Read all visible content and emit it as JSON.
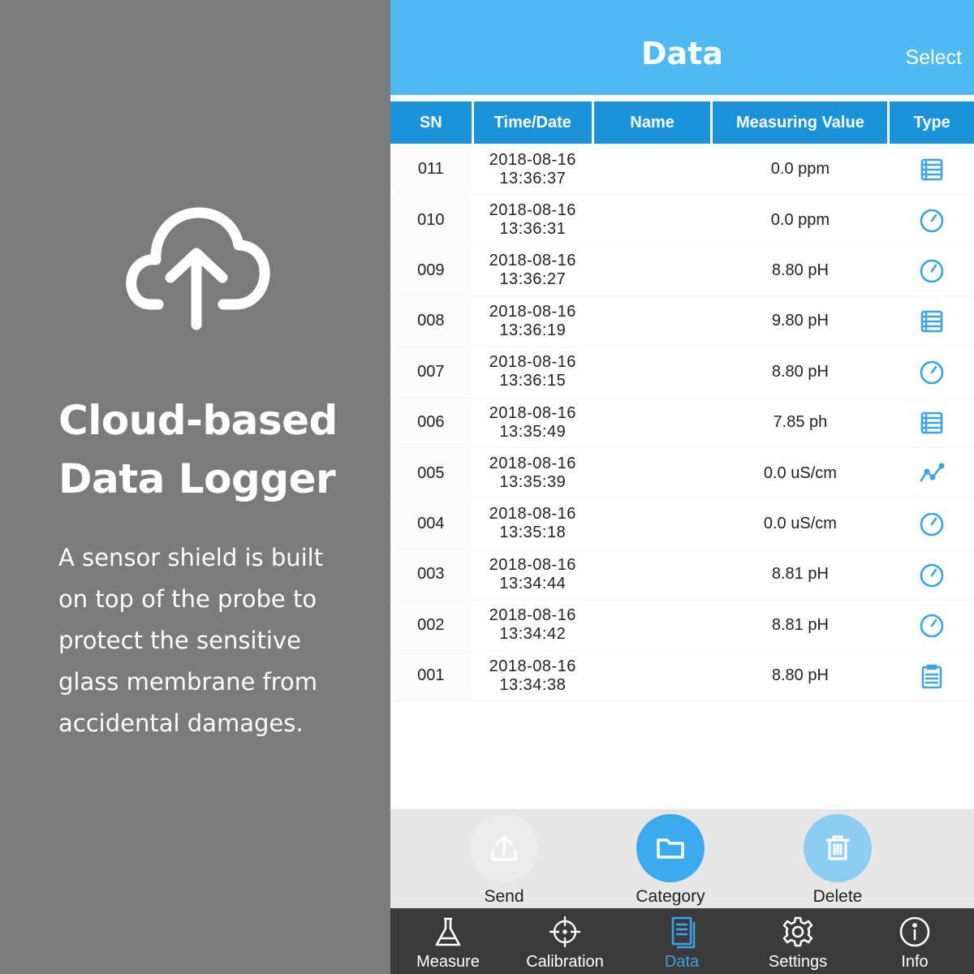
{
  "promo": {
    "icon": "cloud-upload-icon",
    "title_line1": "Cloud-based",
    "title_line2": "Data Logger",
    "description": "A sensor shield is built on top of the probe to protect the sensitive glass membrane from accidental damages."
  },
  "navbar": {
    "title": "Data",
    "select_label": "Select"
  },
  "table": {
    "headers": [
      "SN",
      "Time/Date",
      "Name",
      "Measuring Value",
      "Type"
    ],
    "rows": [
      {
        "sn": "011",
        "date": "2018-08-16",
        "time": "13:36:37",
        "name": "",
        "value": "0.0 ppm",
        "type": "table-icon"
      },
      {
        "sn": "010",
        "date": "2018-08-16",
        "time": "13:36:31",
        "name": "",
        "value": "0.0 ppm",
        "type": "gauge-icon"
      },
      {
        "sn": "009",
        "date": "2018-08-16",
        "time": "13:36:27",
        "name": "",
        "value": "8.80 pH",
        "type": "gauge-icon"
      },
      {
        "sn": "008",
        "date": "2018-08-16",
        "time": "13:36:19",
        "name": "",
        "value": "9.80 pH",
        "type": "table-icon"
      },
      {
        "sn": "007",
        "date": "2018-08-16",
        "time": "13:36:15",
        "name": "",
        "value": "8.80 pH",
        "type": "gauge-icon"
      },
      {
        "sn": "006",
        "date": "2018-08-16",
        "time": "13:35:49",
        "name": "",
        "value": "7.85 ph",
        "type": "table-icon"
      },
      {
        "sn": "005",
        "date": "2018-08-16",
        "time": "13:35:39",
        "name": "",
        "value": "0.0 uS/cm",
        "type": "line-chart-icon"
      },
      {
        "sn": "004",
        "date": "2018-08-16",
        "time": "13:35:18",
        "name": "",
        "value": "0.0 uS/cm",
        "type": "gauge-icon"
      },
      {
        "sn": "003",
        "date": "2018-08-16",
        "time": "13:34:44",
        "name": "",
        "value": "8.81 pH",
        "type": "gauge-icon"
      },
      {
        "sn": "002",
        "date": "2018-08-16",
        "time": "13:34:42",
        "name": "",
        "value": "8.81 pH",
        "type": "gauge-icon"
      },
      {
        "sn": "001",
        "date": "2018-08-16",
        "time": "13:34:38",
        "name": "",
        "value": "8.80 pH",
        "type": "clipboard-icon"
      }
    ]
  },
  "actions": {
    "send_label": "Send",
    "category_label": "Category",
    "delete_label": "Delete"
  },
  "tabs": {
    "measure": "Measure",
    "calibration": "Calibration",
    "data": "Data",
    "settings": "Settings",
    "info": "Info",
    "active": "data"
  },
  "colors": {
    "navbar": "#4fb9f2",
    "header": "#1a93db",
    "icon": "#3aa3e6",
    "promo_bg": "#7b7b7b",
    "tabbar": "#3a3a3a"
  }
}
